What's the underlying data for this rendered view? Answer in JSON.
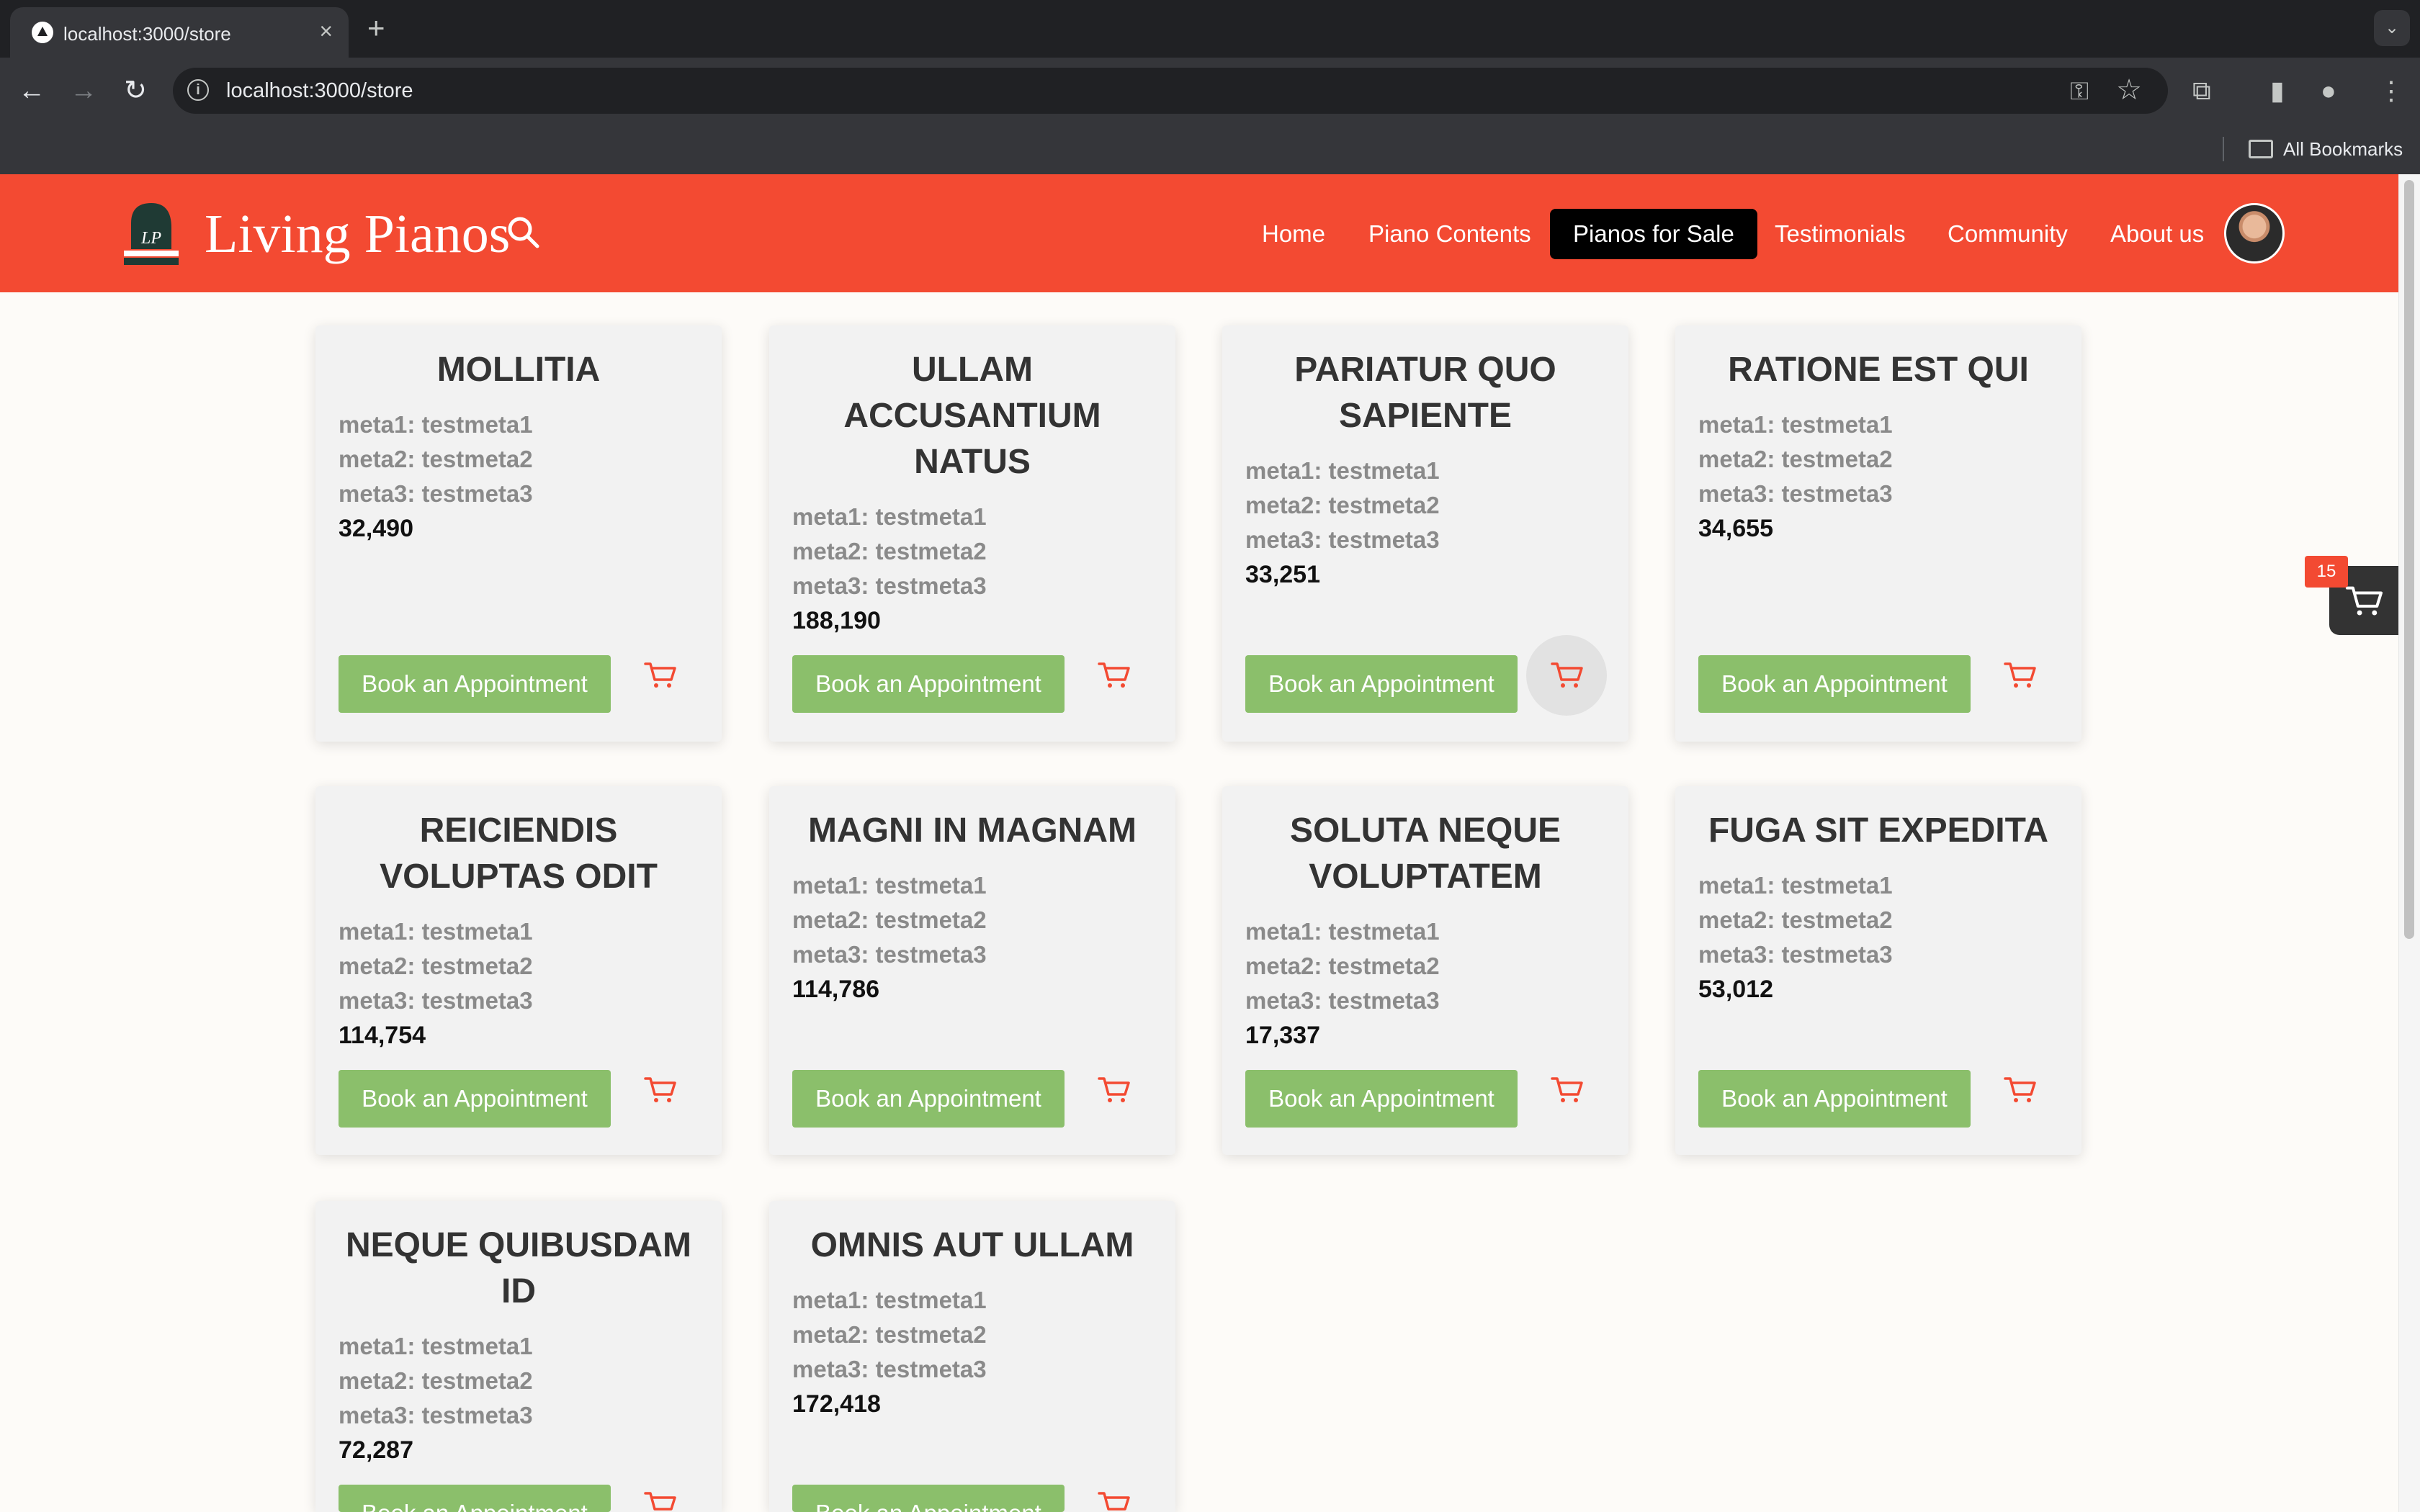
{
  "browser": {
    "tab_title": "localhost:3000/store",
    "url": "localhost:3000/store",
    "bookmarks_label": "All Bookmarks"
  },
  "site": {
    "brand": "Living Pianos",
    "logo_text": "LP",
    "nav": [
      "Home",
      "Piano Contents",
      "Pianos for Sale",
      "Testimonials",
      "Community",
      "About us"
    ],
    "active_nav": "Pianos for Sale"
  },
  "cart": {
    "count": "15"
  },
  "colors": {
    "header": "#f34a32",
    "button": "#8bbf6b",
    "cart_icon": "#f34a32",
    "card": "#f2f2f2"
  },
  "products": [
    {
      "title": "MOLLITIA",
      "meta1": "meta1: testmeta1",
      "meta2": "meta2: testmeta2",
      "meta3": "meta3: testmeta3",
      "price": "32,490",
      "button": "Book an Appointment"
    },
    {
      "title": "ULLAM ACCUSANTIUM NATUS",
      "meta1": "meta1: testmeta1",
      "meta2": "meta2: testmeta2",
      "meta3": "meta3: testmeta3",
      "price": "188,190",
      "button": "Book an Appointment"
    },
    {
      "title": "PARIATUR QUO SAPIENTE",
      "meta1": "meta1: testmeta1",
      "meta2": "meta2: testmeta2",
      "meta3": "meta3: testmeta3",
      "price": "33,251",
      "button": "Book an Appointment"
    },
    {
      "title": "RATIONE EST QUI",
      "meta1": "meta1: testmeta1",
      "meta2": "meta2: testmeta2",
      "meta3": "meta3: testmeta3",
      "price": "34,655",
      "button": "Book an Appointment"
    },
    {
      "title": "REICIENDIS VOLUPTAS ODIT",
      "meta1": "meta1: testmeta1",
      "meta2": "meta2: testmeta2",
      "meta3": "meta3: testmeta3",
      "price": "114,754",
      "button": "Book an Appointment"
    },
    {
      "title": "MAGNI IN MAGNAM",
      "meta1": "meta1: testmeta1",
      "meta2": "meta2: testmeta2",
      "meta3": "meta3: testmeta3",
      "price": "114,786",
      "button": "Book an Appointment"
    },
    {
      "title": "SOLUTA NEQUE VOLUPTATEM",
      "meta1": "meta1: testmeta1",
      "meta2": "meta2: testmeta2",
      "meta3": "meta3: testmeta3",
      "price": "17,337",
      "button": "Book an Appointment"
    },
    {
      "title": "FUGA SIT EXPEDITA",
      "meta1": "meta1: testmeta1",
      "meta2": "meta2: testmeta2",
      "meta3": "meta3: testmeta3",
      "price": "53,012",
      "button": "Book an Appointment"
    },
    {
      "title": "NEQUE QUIBUSDAM ID",
      "meta1": "meta1: testmeta1",
      "meta2": "meta2: testmeta2",
      "meta3": "meta3: testmeta3",
      "price": "72,287",
      "button": "Book an Appointment"
    },
    {
      "title": "OMNIS AUT ULLAM",
      "meta1": "meta1: testmeta1",
      "meta2": "meta2: testmeta2",
      "meta3": "meta3: testmeta3",
      "price": "172,418",
      "button": "Book an Appointment"
    }
  ]
}
